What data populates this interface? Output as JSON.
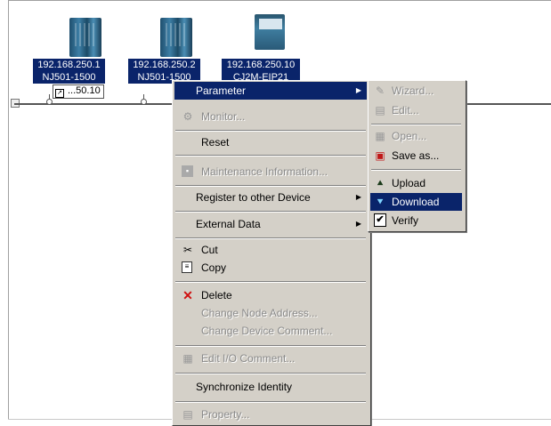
{
  "devices": [
    {
      "ip": "192.168.250.1",
      "model": "NJ501-1500",
      "status": "...50.10"
    },
    {
      "ip": "192.168.250.2",
      "model": "NJ501-1500"
    },
    {
      "ip": "192.168.250.10",
      "model": "CJ2M-EIP21"
    }
  ],
  "context_menu": {
    "parameter": "Parameter",
    "monitor": "Monitor...",
    "reset": "Reset",
    "maintenance": "Maintenance Information...",
    "register": "Register to other Device",
    "external": "External Data",
    "cut": "Cut",
    "copy": "Copy",
    "delete": "Delete",
    "change_node": "Change Node Address...",
    "change_comment": "Change Device Comment...",
    "edit_io": "Edit I/O Comment...",
    "sync": "Synchronize Identity",
    "property": "Property..."
  },
  "parameter_submenu": {
    "wizard": "Wizard...",
    "edit": "Edit...",
    "open": "Open...",
    "save_as": "Save as...",
    "upload": "Upload",
    "download": "Download",
    "verify": "Verify"
  },
  "icons": {
    "verify": "✔",
    "cut": "✂",
    "delete": "✕",
    "submenu_arrow": "▶"
  },
  "colors": {
    "selection": "#0a246a",
    "menu_bg": "#d4d0c8",
    "delete_icon": "#d01010"
  }
}
